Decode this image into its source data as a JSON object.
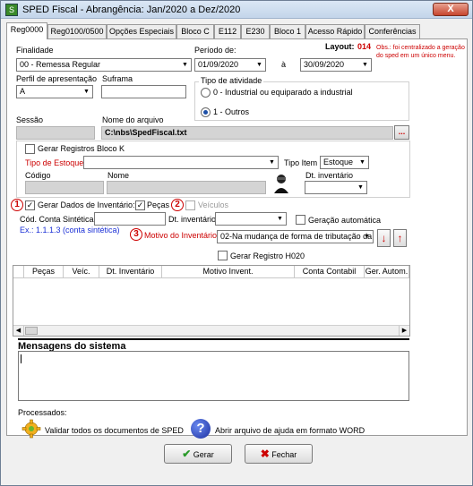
{
  "window": {
    "title": "SPED Fiscal - Abrangência: Jan/2020 a Dez/2020",
    "close": "X"
  },
  "tabs": [
    "Reg0000",
    "Reg0100/0500",
    "Opções Especiais",
    "Bloco C",
    "E112",
    "E230",
    "Bloco 1",
    "Acesso Rápido",
    "Conferências"
  ],
  "form": {
    "finalidade_label": "Finalidade",
    "finalidade_value": "00 - Remessa Regular",
    "periodo_label": "Período de:",
    "periodo_de": "01/09/2020",
    "periodo_sep": "à",
    "periodo_ate": "30/09/2020",
    "layout_label": "Layout:",
    "layout_value": "014",
    "obs": "Obs.: foi centralizado a geração do sped em um único menu.",
    "perfil_label": "Perfil de apresentação",
    "perfil_value": "A",
    "suframa_label": "Suframa",
    "suframa_value": "",
    "tipo_atividade_label": "Tipo de atividade",
    "tipo_atividade_opt0": "0 - Industrial ou equiparado a industrial",
    "tipo_atividade_opt1": "1 - Outros",
    "sessao_label": "Sessão",
    "nome_arquivo_label": "Nome do arquivo",
    "nome_arquivo_value": "C:\\nbs\\SpedFiscal.txt",
    "browse_label": "...",
    "gerar_bloco_k_label": "Gerar Registros Bloco K",
    "tipo_estoque_label": "Tipo de Estoque",
    "tipo_item_label": "Tipo Item",
    "tipo_item_value": "Estoque",
    "codigo_label": "Código",
    "nome_label": "Nome",
    "dt_inventario_k_label": "Dt. inventário",
    "marker1": "1",
    "gerar_dados_inv_label": "Gerar Dados de Inventário:",
    "pecas_label": "Peças",
    "marker2": "2",
    "veiculos_label": "Veículos",
    "cod_conta_label": "Cód. Conta Sintética",
    "cod_conta_example": "Ex.: 1.1.1.3 (conta sintética)",
    "dt_inventario_label": "Dt. inventário",
    "geracao_auto_label": "Geração automática",
    "marker3": "3",
    "motivo_label": "Motivo do Inventário",
    "motivo_value": "02-Na mudança de forma de tributação da",
    "gerar_h020_label": "Gerar Registro H020"
  },
  "grid": {
    "columns": [
      "Peças",
      "Veíc.",
      "Dt. Inventário",
      "Motivo Invent.",
      "Conta Contabil",
      "Ger. Autom."
    ]
  },
  "messages": {
    "title": "Mensagens do sistema"
  },
  "footer": {
    "processados_label": "Processados:",
    "validar_label": "Validar todos os documentos de SPED",
    "ajuda_label": "Abrir arquivo de ajuda em formato WORD",
    "gerar_label": "Gerar",
    "fechar_label": "Fechar"
  },
  "colors": {
    "accent_red": "#cc0000",
    "link_blue": "#1a2fd6",
    "field_gray": "#d4d4d4"
  },
  "icons": [
    "sped-app-icon",
    "calendar-icon",
    "person-silhouette-icon",
    "arrow-down-icon",
    "arrow-up-icon",
    "gear-icon",
    "help-icon",
    "checkmark-icon",
    "x-icon"
  ]
}
